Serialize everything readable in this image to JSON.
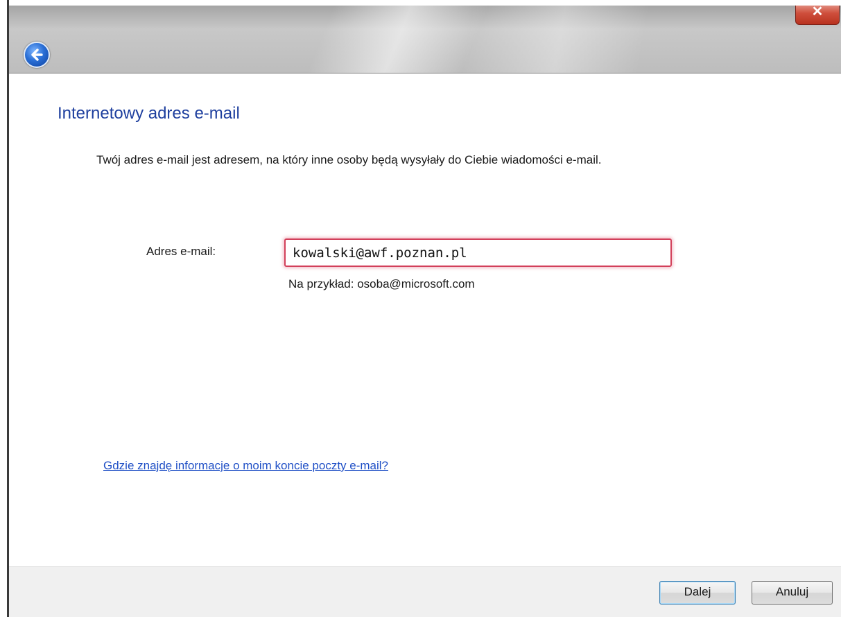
{
  "window": {
    "close_symbol": "✕",
    "back_icon": "back-arrow-icon"
  },
  "page": {
    "title": "Internetowy adres e-mail",
    "description": "Twój adres e-mail jest adresem, na który inne osoby będą wysyłały do Ciebie wiadomości e-mail."
  },
  "form": {
    "email_label": "Adres e-mail:",
    "email_value": "kowalski@awf.poznan.pl",
    "email_hint": "Na przykład: osoba@microsoft.com"
  },
  "help_link": "Gdzie znajdę informacje o moim koncie poczty e-mail?",
  "footer": {
    "next_label": "Dalej",
    "cancel_label": "Anuluj"
  },
  "colors": {
    "title": "#1e3f9e",
    "link": "#1f4fc6",
    "input_focus_border": "#d2405a"
  }
}
